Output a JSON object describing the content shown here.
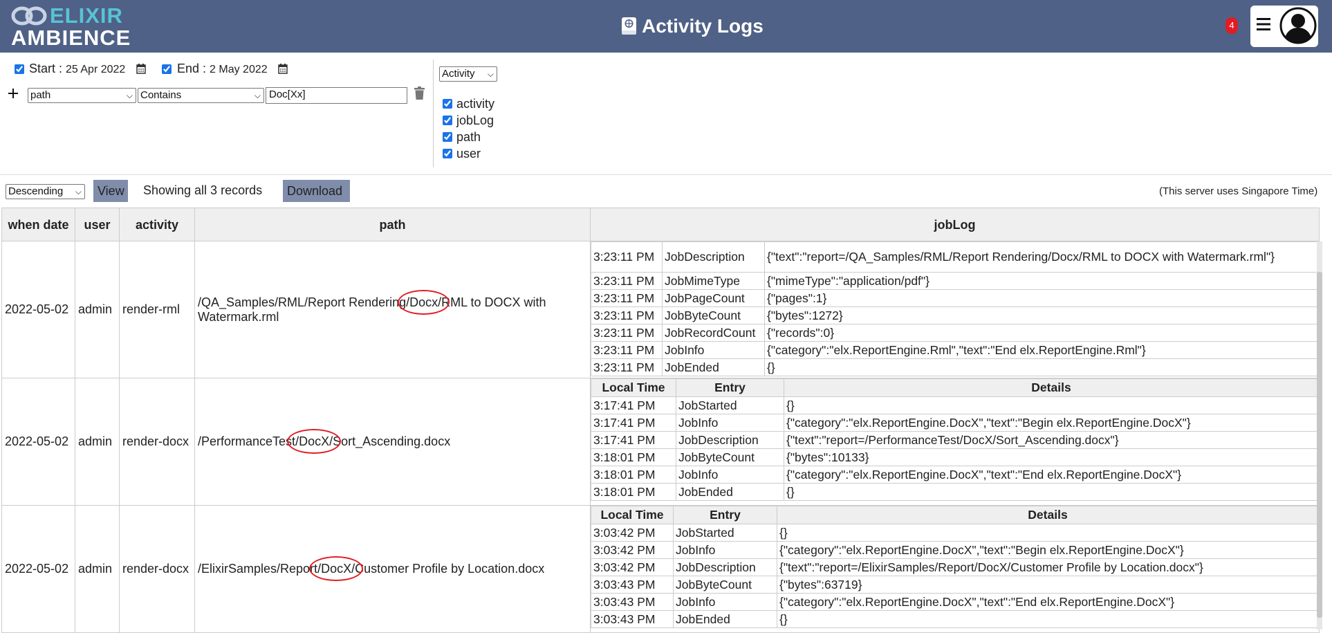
{
  "header": {
    "logo_line1": "ELIXIR",
    "logo_line2": "AMBIENCE",
    "title": "Activity Logs",
    "notification_count": "4",
    "colors": {
      "bar": "#4f6186",
      "logo_accent": "#59c3d6",
      "badge": "#e31b23"
    }
  },
  "filters": {
    "start_label": "Start : ",
    "start_date": "25 Apr 2022",
    "end_label": "End : ",
    "end_date": "2 May 2022",
    "field": "path",
    "operator": "Contains",
    "value": "Doc[Xx]",
    "mode": "Activity",
    "columns": [
      {
        "label": "activity",
        "checked": true
      },
      {
        "label": "jobLog",
        "checked": true
      },
      {
        "label": "path",
        "checked": true
      },
      {
        "label": "user",
        "checked": true
      }
    ]
  },
  "toolbar": {
    "sort": "Descending",
    "view_label": "View",
    "record_text": "Showing all 3 records",
    "download_label": "Download",
    "timezone_note": "(This server uses Singapore Time)"
  },
  "table": {
    "headers": [
      "when date",
      "user",
      "activity",
      "path",
      "jobLog"
    ],
    "subheaders": [
      "Local Time",
      "Entry",
      "Details"
    ],
    "rows": [
      {
        "date": "2022-05-02",
        "user": "admin",
        "activity": "render-rml",
        "path_pre": "/QA_Samples/RML/Report Rendering",
        "path_hl": "/Docx/",
        "path_post": "RML to DOCX with Watermark.rml",
        "log": [
          {
            "time": "3:23:11 PM",
            "entry": "JobDescription",
            "details": "{\"text\":\"report=/QA_Samples/RML/Report Rendering/Docx/RML to DOCX with Watermark.rml\"}"
          },
          {
            "time": "3:23:11 PM",
            "entry": "JobMimeType",
            "details": "{\"mimeType\":\"application/pdf\"}"
          },
          {
            "time": "3:23:11 PM",
            "entry": "JobPageCount",
            "details": "{\"pages\":1}"
          },
          {
            "time": "3:23:11 PM",
            "entry": "JobByteCount",
            "details": "{\"bytes\":1272}"
          },
          {
            "time": "3:23:11 PM",
            "entry": "JobRecordCount",
            "details": "{\"records\":0}"
          },
          {
            "time": "3:23:11 PM",
            "entry": "JobInfo",
            "details": "{\"category\":\"elx.ReportEngine.Rml\",\"text\":\"End elx.ReportEngine.Rml\"}"
          },
          {
            "time": "3:23:11 PM",
            "entry": "JobEnded",
            "details": "{}"
          }
        ]
      },
      {
        "date": "2022-05-02",
        "user": "admin",
        "activity": "render-docx",
        "path_pre": "/PerformanceTest",
        "path_hl": "/DocX/",
        "path_post": "Sort_Ascending.docx",
        "log": [
          {
            "time": "3:17:41 PM",
            "entry": "JobStarted",
            "details": "{}"
          },
          {
            "time": "3:17:41 PM",
            "entry": "JobInfo",
            "details": "{\"category\":\"elx.ReportEngine.DocX\",\"text\":\"Begin elx.ReportEngine.DocX\"}"
          },
          {
            "time": "3:17:41 PM",
            "entry": "JobDescription",
            "details": "{\"text\":\"report=/PerformanceTest/DocX/Sort_Ascending.docx\"}"
          },
          {
            "time": "3:18:01 PM",
            "entry": "JobByteCount",
            "details": "{\"bytes\":10133}"
          },
          {
            "time": "3:18:01 PM",
            "entry": "JobInfo",
            "details": "{\"category\":\"elx.ReportEngine.DocX\",\"text\":\"End elx.ReportEngine.DocX\"}"
          },
          {
            "time": "3:18:01 PM",
            "entry": "JobEnded",
            "details": "{}"
          }
        ]
      },
      {
        "date": "2022-05-02",
        "user": "admin",
        "activity": "render-docx",
        "path_pre": "/ElixirSamples/Report",
        "path_hl": "/DocX/",
        "path_post": "Customer Profile by Location.docx",
        "log": [
          {
            "time": "3:03:42 PM",
            "entry": "JobStarted",
            "details": "{}"
          },
          {
            "time": "3:03:42 PM",
            "entry": "JobInfo",
            "details": "{\"category\":\"elx.ReportEngine.DocX\",\"text\":\"Begin elx.ReportEngine.DocX\"}"
          },
          {
            "time": "3:03:42 PM",
            "entry": "JobDescription",
            "details": "{\"text\":\"report=/ElixirSamples/Report/DocX/Customer Profile by Location.docx\"}"
          },
          {
            "time": "3:03:43 PM",
            "entry": "JobByteCount",
            "details": "{\"bytes\":63719}"
          },
          {
            "time": "3:03:43 PM",
            "entry": "JobInfo",
            "details": "{\"category\":\"elx.ReportEngine.DocX\",\"text\":\"End elx.ReportEngine.DocX\"}"
          },
          {
            "time": "3:03:43 PM",
            "entry": "JobEnded",
            "details": "{}"
          }
        ]
      }
    ]
  }
}
